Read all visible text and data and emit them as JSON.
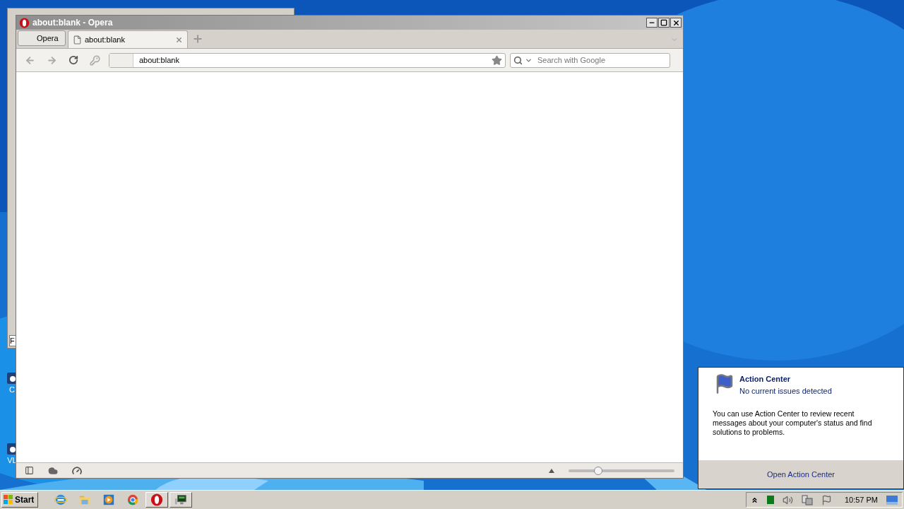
{
  "background_window": {
    "fragment": "F"
  },
  "desktop_icons": [
    {
      "label": "C"
    },
    {
      "label": "VL"
    }
  ],
  "browser": {
    "title": "about:blank - Opera",
    "menu_button": "Opera",
    "tabs": [
      {
        "label": "about:blank",
        "selected": true
      }
    ],
    "address": "about:blank",
    "search": {
      "placeholder": "Search with Google"
    },
    "zoom": {
      "level": 0.28
    }
  },
  "action_center": {
    "title": "Action Center",
    "status": "No current issues detected",
    "message": "You can use Action Center to review recent messages about your computer's status and find solutions to problems.",
    "link": "Open Action Center"
  },
  "taskbar": {
    "start": "Start",
    "apps": [
      {
        "kind": "ie",
        "running": false
      },
      {
        "kind": "folder",
        "running": false
      },
      {
        "kind": "media",
        "running": false
      },
      {
        "kind": "chrome",
        "running": false
      },
      {
        "kind": "opera",
        "running": true
      },
      {
        "kind": "monitor",
        "running": true
      }
    ],
    "clock": "10:57 PM"
  }
}
